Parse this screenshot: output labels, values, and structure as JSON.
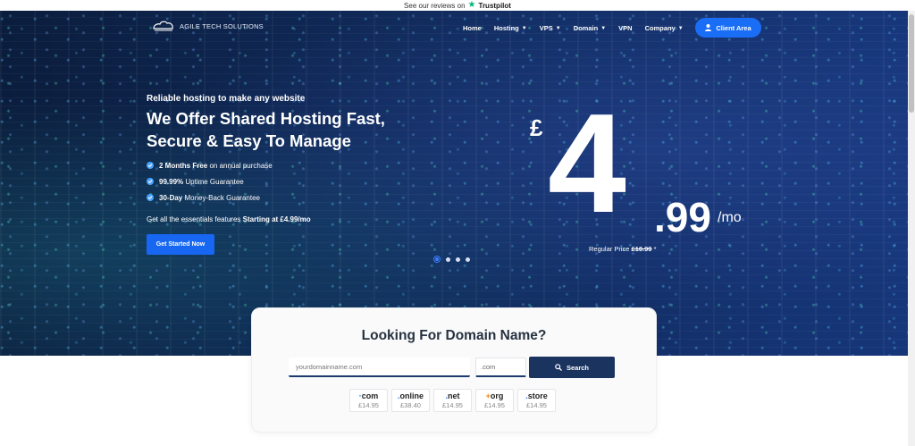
{
  "trustbar": {
    "text": "See our reviews on",
    "brand": "Trustpilot"
  },
  "brand": {
    "logo_text": "AGILE TECH SOLUTIONS"
  },
  "nav": {
    "items": [
      {
        "label": "Home",
        "has_caret": false
      },
      {
        "label": "Hosting",
        "has_caret": true
      },
      {
        "label": "VPS",
        "has_caret": true
      },
      {
        "label": "Domain",
        "has_caret": true
      },
      {
        "label": "VPN",
        "has_caret": false
      },
      {
        "label": "Company",
        "has_caret": true
      }
    ],
    "client_area": "Client Area"
  },
  "hero": {
    "subtitle": "Reliable hosting to make any website",
    "title": "We Offer Shared Hosting Fast, Secure & Easy To Manage",
    "features": [
      {
        "bold": "2 Months Free",
        "rest": " on annual purchase"
      },
      {
        "bold": "99.99%",
        "rest": " Uptime Guarantee"
      },
      {
        "bold": "30-Day",
        "rest": " Money-Back Guarantee"
      }
    ],
    "essentials_text": "Get all the essentials features ",
    "essentials_bold": "Starting at £4.99/mo",
    "cta": "Get Started Now"
  },
  "price": {
    "currency": "£",
    "whole": "4",
    "decimals": ".99",
    "period": "/mo",
    "regular_label": "Regular Price ",
    "regular_value": "£10.99",
    "regular_suffix": " *"
  },
  "slider": {
    "count": 4,
    "active_index": 0
  },
  "domain": {
    "title": "Looking For Domain Name?",
    "input_placeholder": "yourdomainname.com",
    "tld_selected": ".com",
    "search_label": "Search",
    "tlds": [
      {
        "prefix": "·",
        "name": "com",
        "price": "£14.95"
      },
      {
        "prefix": ".",
        "name": "online",
        "price": "£38.40"
      },
      {
        "prefix": ".",
        "name": "net",
        "price": "£14.95"
      },
      {
        "prefix": "+",
        "name": "org",
        "price": "£14.95"
      },
      {
        "prefix": ".",
        "name": "store",
        "price": "£14.95"
      }
    ]
  },
  "colors": {
    "accent": "#1a6df5",
    "navy": "#1b335f",
    "check": "#49a3ff",
    "trustpilot": "#00b67a"
  }
}
